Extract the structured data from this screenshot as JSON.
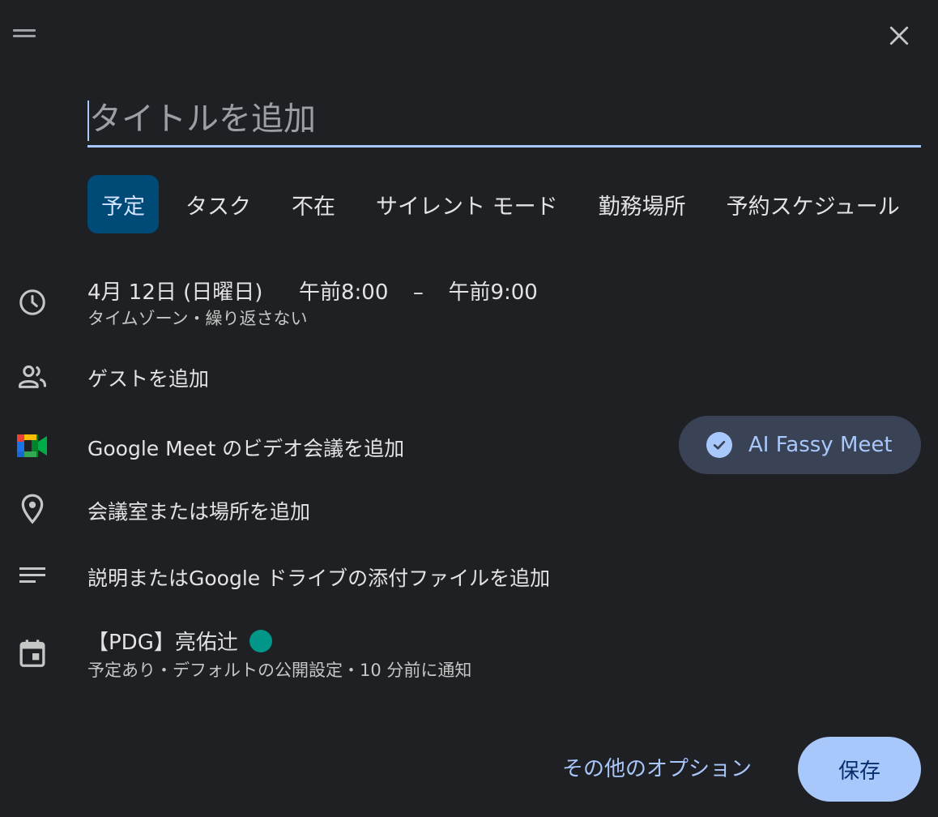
{
  "title_field": {
    "placeholder": "タイトルを追加",
    "value": ""
  },
  "tabs": [
    {
      "label": "予定",
      "active": true
    },
    {
      "label": "タスク",
      "active": false
    },
    {
      "label": "不在",
      "active": false
    },
    {
      "label": "サイレント モード",
      "active": false
    },
    {
      "label": "勤務場所",
      "active": false
    },
    {
      "label": "予約スケジュール",
      "active": false
    }
  ],
  "datetime": {
    "date": "4月 12日 (日曜日)",
    "start": "午前8:00",
    "separator": "–",
    "end": "午前9:00",
    "sub": "タイムゾーン・繰り返さない"
  },
  "guests": {
    "label": "ゲストを追加"
  },
  "meet": {
    "label": "Google Meet のビデオ会議を追加",
    "chip_label": "AI Fassy Meet"
  },
  "location": {
    "label": "会議室または場所を追加"
  },
  "description": {
    "label": "説明またはGoogle ドライブの添付ファイルを追加"
  },
  "calendar": {
    "name": "【PDG】亮佑辻",
    "color": "#009688",
    "sub": "予定あり・デフォルトの公開設定・10 分前に通知"
  },
  "footer": {
    "more_options": "その他のオプション",
    "save": "保存"
  },
  "colors": {
    "background": "#1f2023",
    "accent": "#a8c7fa",
    "active_tab": "#004a77",
    "chip": "#3a4356"
  }
}
